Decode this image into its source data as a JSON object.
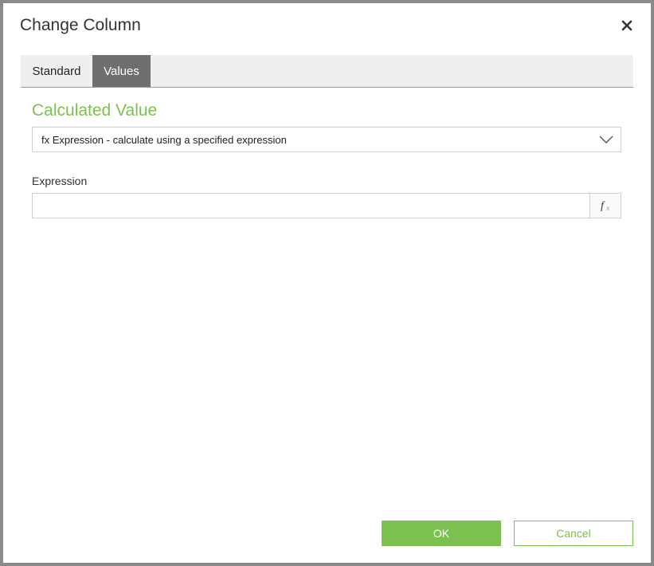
{
  "dialog": {
    "title": "Change Column",
    "close_icon": "close-icon"
  },
  "tabs": [
    {
      "label": "Standard",
      "active": false
    },
    {
      "label": "Values",
      "active": true
    }
  ],
  "section": {
    "title": "Calculated Value"
  },
  "calc_type": {
    "selected": "fx Expression - calculate using a specified expression",
    "icon": "chevron-down-icon"
  },
  "expression": {
    "label": "Expression",
    "value": "",
    "fx_icon": "function-icon"
  },
  "footer": {
    "ok_label": "OK",
    "cancel_label": "Cancel"
  },
  "colors": {
    "accent": "#7cc14f",
    "active_tab": "#6f6f6f",
    "tabbar_bg": "#efefef"
  }
}
